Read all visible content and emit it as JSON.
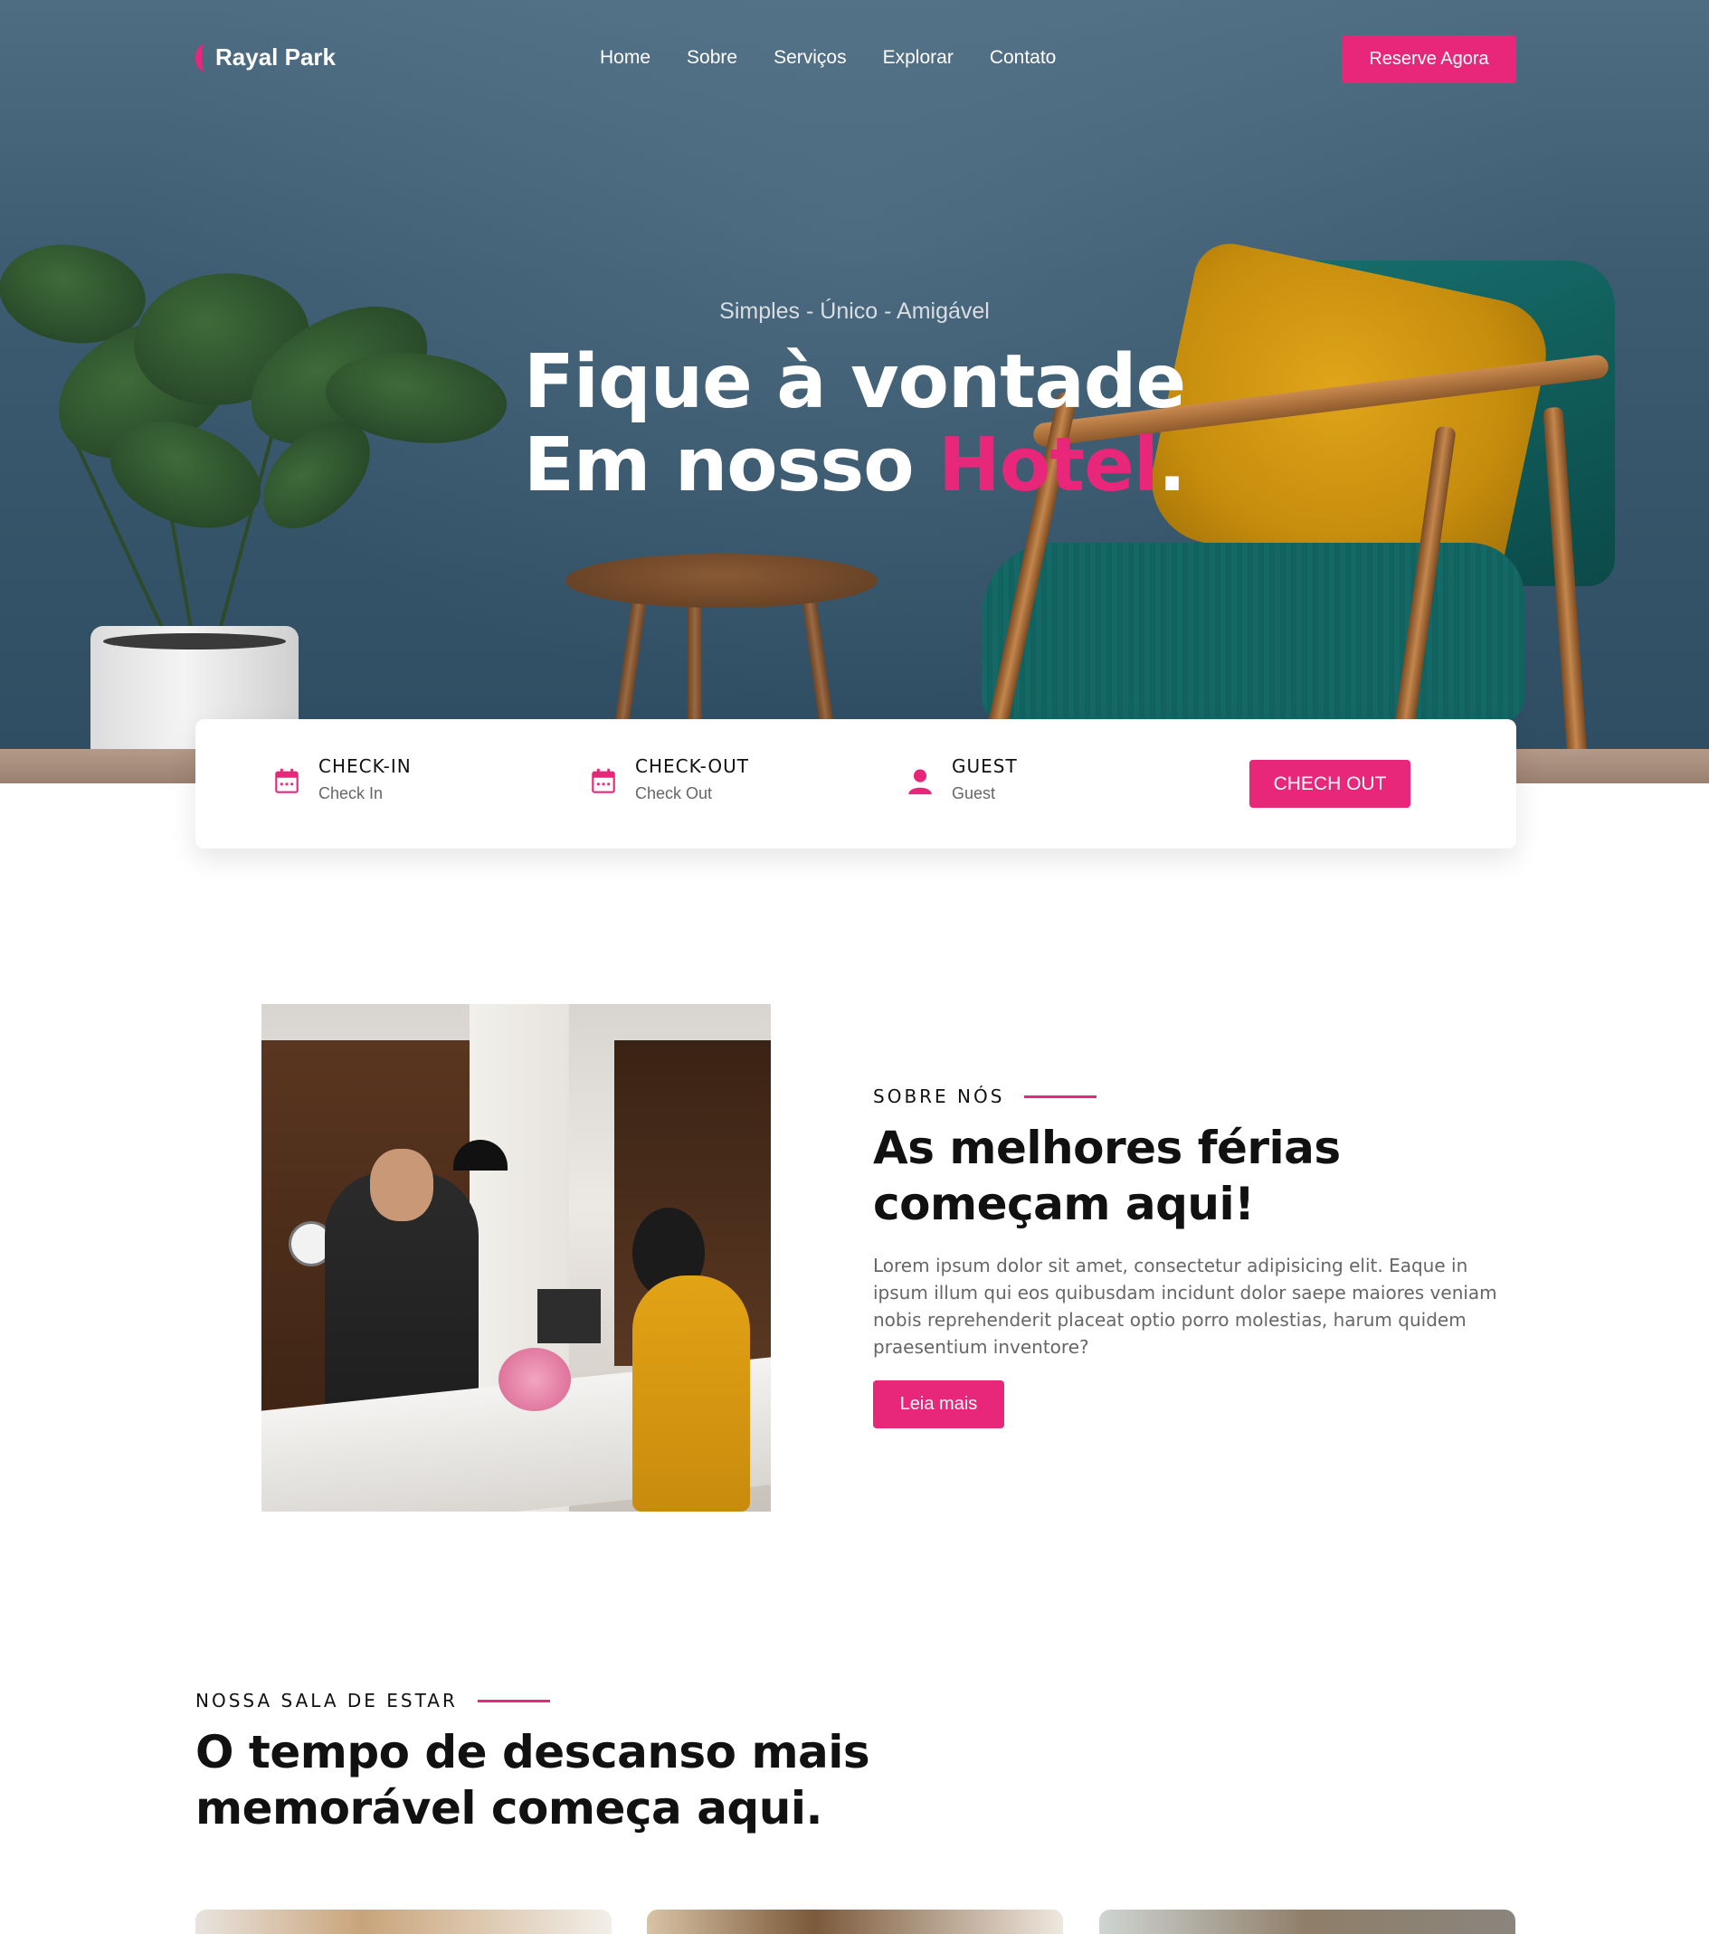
{
  "brand": {
    "name": "Rayal Park",
    "accent_color": "#e8267a"
  },
  "nav": {
    "links": [
      "Home",
      "Sobre",
      "Serviços",
      "Explorar",
      "Contato"
    ],
    "cta_label": "Reserve Agora"
  },
  "hero": {
    "subtitle": "Simples - Único - Amigável",
    "title_line1": "Fique à vontade",
    "title_line2_prefix": "Em nosso ",
    "title_highlight": "Hotel",
    "title_suffix": "."
  },
  "booking": {
    "checkin": {
      "label": "CHECK-IN",
      "value": "Check In",
      "icon": "calendar-icon"
    },
    "checkout": {
      "label": "CHECK-OUT",
      "value": "Check Out",
      "icon": "calendar-icon"
    },
    "guest": {
      "label": "GUEST",
      "value": "Guest",
      "icon": "user-icon"
    },
    "button_label": "CHECH OUT"
  },
  "about": {
    "eyebrow": "SOBRE NÓS",
    "title_line1": "As melhores férias",
    "title_line2": "começam aqui!",
    "paragraph": "Lorem ipsum dolor sit amet, consectetur adipisicing elit. Eaque in ipsum illum qui eos quibusdam incidunt dolor saepe maiores veniam nobis reprehenderit placeat optio porro molestias, harum quidem praesentium inventore?",
    "button_label": "Leia mais"
  },
  "rooms": {
    "eyebrow": "NOSSA SALA DE ESTAR",
    "title_line1": "O tempo de descanso mais",
    "title_line2": "memorável começa aqui."
  }
}
